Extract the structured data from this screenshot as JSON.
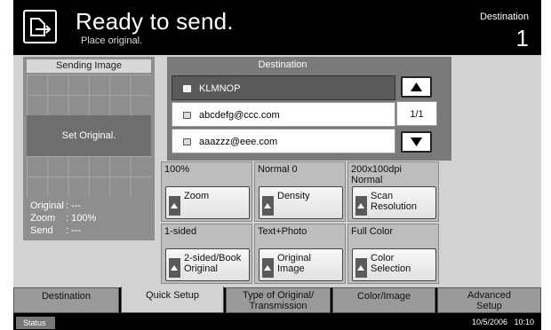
{
  "header": {
    "title": "Ready to send.",
    "subtitle": "Place original.",
    "destination_label": "Destination",
    "destination_count": "1"
  },
  "sending_image": {
    "title": "Sending Image",
    "message": "Set Original.",
    "info": [
      {
        "key": "Original",
        "value": ": ---"
      },
      {
        "key": "Zoom",
        "value": ": 100%"
      },
      {
        "key": "Send",
        "value": ": ---"
      }
    ]
  },
  "destination_panel": {
    "title": "Destination",
    "entries": [
      "KLMNOP",
      "abcdefg@ccc.com",
      "aaazzz@eee.com"
    ],
    "page": "1/1",
    "up_icon": "up-arrow-icon",
    "down_icon": "down-arrow-icon"
  },
  "settings": [
    {
      "value": "100%",
      "label": "Zoom"
    },
    {
      "value": "Normal 0",
      "label": "Density"
    },
    {
      "value": "200x100dpi\nNormal",
      "label": "Scan\nResolution"
    },
    {
      "value": "1-sided",
      "label": "2-sided/Book\nOriginal"
    },
    {
      "value": "Text+Photo",
      "label": "Original\nImage"
    },
    {
      "value": "Full Color",
      "label": "Color\nSelection"
    }
  ],
  "tabs": [
    {
      "label": "Destination"
    },
    {
      "label": "Quick Setup"
    },
    {
      "label": "Type of Original/\nTransmission"
    },
    {
      "label": "Color/Image"
    },
    {
      "label": "Advanced\nSetup"
    }
  ],
  "status": {
    "button_label": "Status",
    "datetime": "10/5/2006   10:10"
  }
}
